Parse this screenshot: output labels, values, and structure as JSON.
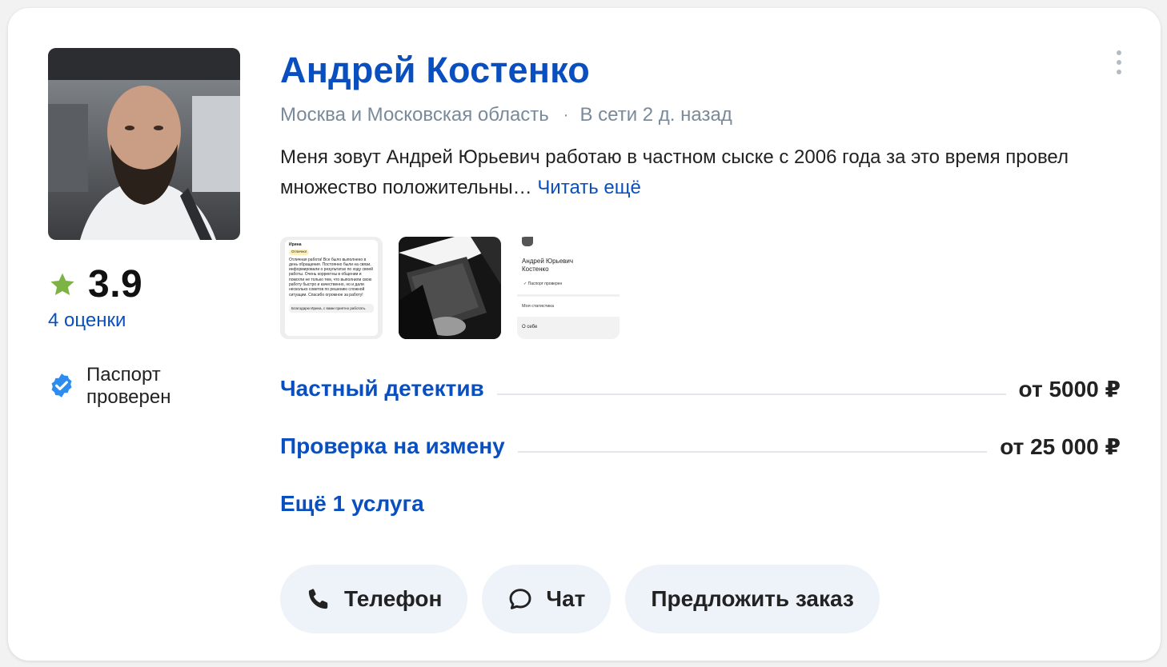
{
  "profile": {
    "name": "Андрей Костенко",
    "location": "Москва и Московская область",
    "online": "В сети 2 д. назад",
    "description": "Меня зовут Андрей Юрьевич работаю в частном сыске с 2006 года за это время провел множество положительны…",
    "read_more": "Читать ещё",
    "rating": "3.9",
    "reviews": "4 оценки",
    "passport": "Паспорт проверен"
  },
  "thumbnails": {
    "review": {
      "name": "Ирина",
      "badge": "Отлично!",
      "text": "Отличная работа! Все было выполнено в день обращения. Постоянно были на связи, информировали о результатах по ходу своей работы. Очень корректны в общении и помогли не только тем, что выполнили свою работу быстро и качественно, но и дали несколько советов по решению сложной ситуации. Спасибо огромное за работу!",
      "reply": "Благодарю Ирина, с вами приятно работать."
    },
    "profile_shot": {
      "name": "Андрей Юрьевич Костенко",
      "passport": "Паспорт проверен",
      "stats": "Моя статистика",
      "about": "О себе"
    }
  },
  "services": [
    {
      "title": "Частный детектив",
      "price": "от 5000 ₽"
    },
    {
      "title": "Проверка на измену",
      "price": "от 25 000 ₽"
    }
  ],
  "more_services": "Ещё 1 услуга",
  "buttons": {
    "phone": "Телефон",
    "chat": "Чат",
    "offer": "Предложить заказ"
  },
  "colors": {
    "accent": "#0a4fbf",
    "star": "#7cb342",
    "verified": "#2d8cf0",
    "button_bg": "#eef3f9"
  },
  "icons": [
    "star-icon",
    "verified-icon",
    "phone-icon",
    "chat-icon",
    "kebab-menu-icon"
  ]
}
